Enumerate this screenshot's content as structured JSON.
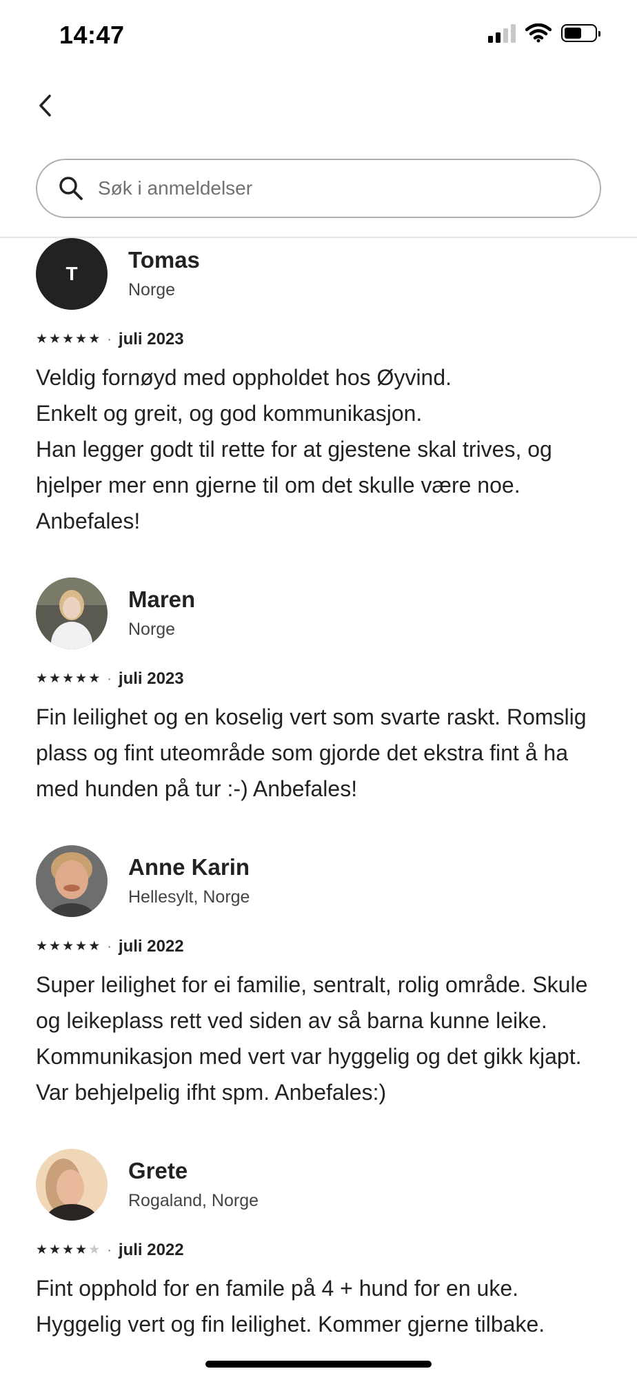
{
  "status_bar": {
    "time": "14:47",
    "signal_bars_active": 2,
    "signal_bars_total": 4,
    "battery_level": 0.6
  },
  "navigation": {
    "back_icon": "chevron-left-icon"
  },
  "search": {
    "placeholder": "Søk i anmeldelser",
    "value": "",
    "icon": "search-icon"
  },
  "reviews": [
    {
      "name": "Tomas",
      "location": "Norge",
      "avatar": {
        "type": "initial",
        "initial": "T",
        "color": "#222222"
      },
      "rating": 5,
      "rating_max": 5,
      "date": "juli 2023",
      "text": "Veldig fornøyd med oppholdet hos Øyvind.\nEnkelt og greit, og god kommunikasjon.\nHan legger godt til rette for at gjestene skal trives, og hjelper mer enn gjerne til om det skulle være noe.\nAnbefales!"
    },
    {
      "name": "Maren",
      "location": "Norge",
      "avatar": {
        "type": "photo",
        "colors": [
          "#5a5a50",
          "#e9d3c0",
          "#d9b98a",
          "#f2f0f2"
        ]
      },
      "rating": 5,
      "rating_max": 5,
      "date": "juli 2023",
      "text": "Fin leilighet og en koselig vert som svarte raskt. Romslig plass og fint uteområde som gjorde det ekstra fint å ha med hunden på tur :-) Anbefales!"
    },
    {
      "name": "Anne Karin",
      "location": "Hellesylt, Norge",
      "avatar": {
        "type": "photo",
        "colors": [
          "#6e6e6e",
          "#e0ab8c",
          "#b36a4c",
          "#3d3d3d"
        ]
      },
      "rating": 5,
      "rating_max": 5,
      "date": "juli 2022",
      "text": "Super leilighet for ei familie, sentralt, rolig område. Skule og leikeplass rett ved siden av så barna kunne leike.  Kommunikasjon med vert var hyggelig og det gikk kjapt. Var behjelpelig ifht spm. Anbefales:)"
    },
    {
      "name": "Grete",
      "location": "Rogaland, Norge",
      "avatar": {
        "type": "photo",
        "colors": [
          "#f0d7b8",
          "#e8b99a",
          "#2a2422",
          "#caa07a"
        ]
      },
      "rating": 4,
      "rating_max": 5,
      "date": "juli 2022",
      "text": "Fint opphold for en famile på 4 + hund for en uke.\nHyggelig vert og fin leilighet. Kommer gjerne tilbake."
    }
  ]
}
